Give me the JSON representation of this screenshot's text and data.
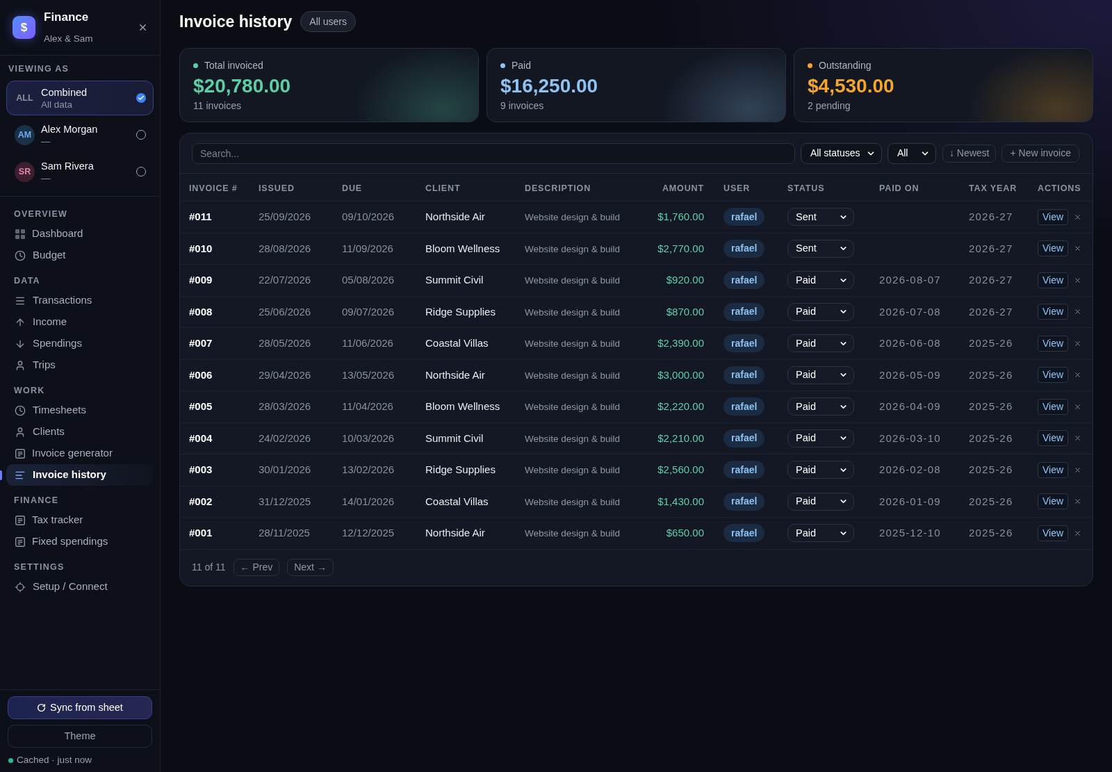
{
  "sidebar": {
    "app": {
      "logo": "$",
      "title": "Finance",
      "subtitle": "Alex & Sam"
    },
    "viewing_as": {
      "heading": "VIEWING AS",
      "options": [
        {
          "kind": "all",
          "badge": "ALL",
          "name": "Combined",
          "detail": "All data",
          "selected": true
        },
        {
          "kind": "person",
          "badge": "AM",
          "name": "Alex Morgan",
          "detail": "—",
          "selected": false,
          "color": "#1b3148"
        },
        {
          "kind": "person",
          "badge": "SR",
          "name": "Sam Rivera",
          "detail": "—",
          "selected": false,
          "color": "#3d1f2e"
        }
      ]
    },
    "nav": [
      {
        "heading": "OVERVIEW",
        "items": [
          {
            "label": "Dashboard",
            "selected": false
          },
          {
            "label": "Budget",
            "selected": false
          }
        ]
      },
      {
        "heading": "DATA",
        "items": [
          {
            "label": "Transactions",
            "selected": false
          },
          {
            "label": "Income",
            "selected": false
          },
          {
            "label": "Spendings",
            "selected": false
          },
          {
            "label": "Trips",
            "selected": false
          }
        ]
      },
      {
        "heading": "WORK",
        "items": [
          {
            "label": "Timesheets",
            "selected": false
          },
          {
            "label": "Clients",
            "selected": false
          },
          {
            "label": "Invoice generator",
            "selected": false
          },
          {
            "label": "Invoice history",
            "selected": true
          }
        ]
      },
      {
        "heading": "FINANCE",
        "items": [
          {
            "label": "Tax tracker",
            "selected": false
          },
          {
            "label": "Fixed spendings",
            "selected": false
          }
        ]
      },
      {
        "heading": "SETTINGS",
        "items": [
          {
            "label": "Setup / Connect",
            "selected": false
          }
        ]
      }
    ],
    "sync_button": "Sync from sheet",
    "theme_button": "Theme",
    "status": "Cached · just now"
  },
  "header": {
    "title": "Invoice history",
    "scope": "All users"
  },
  "summary_cards": [
    {
      "label": "Total invoiced",
      "value": "$20,780.00",
      "note": "11 invoices",
      "color": "#5ccfa5"
    },
    {
      "label": "Paid",
      "value": "$16,250.00",
      "note": "9 invoices",
      "color": "#8ec3f2"
    },
    {
      "label": "Outstanding",
      "value": "$4,530.00",
      "note": "2 pending",
      "color": "#f4a52a"
    }
  ],
  "invoices": {
    "search": {
      "placeholder": "Search..."
    },
    "status_filter": "All statuses",
    "period_filter": "All",
    "sort_button": "↓ Newest",
    "new_button": "+ New invoice",
    "columns": [
      "INVOICE #",
      "ISSUED",
      "DUE",
      "CLIENT",
      "DESCRIPTION",
      "AMOUNT",
      "USER",
      "STATUS",
      "PAID ON",
      "TAX YEAR",
      "ACTIONS"
    ],
    "rows": [
      {
        "invoice": "#011",
        "issued": "25/09/2026",
        "due": "09/10/2026",
        "client": "Northside Air",
        "description": "Website design & build",
        "amount": "$1,760.00",
        "user": "rafael",
        "status": "Sent",
        "tax_year": "2026-27",
        "action": "View"
      },
      {
        "invoice": "#010",
        "issued": "28/08/2026",
        "due": "11/09/2026",
        "client": "Bloom Wellness",
        "description": "Website design & build",
        "amount": "$2,770.00",
        "user": "rafael",
        "status": "Sent",
        "tax_year": "2026-27",
        "action": "View"
      },
      {
        "invoice": "#009",
        "issued": "22/07/2026",
        "due": "05/08/2026",
        "client": "Summit Civil",
        "description": "Website design & build",
        "amount": "$920.00",
        "user": "rafael",
        "status": "Paid",
        "paid_on": "2026-08-07",
        "tax_year": "2026-27",
        "action": "View"
      },
      {
        "invoice": "#008",
        "issued": "25/06/2026",
        "due": "09/07/2026",
        "client": "Ridge Supplies",
        "description": "Website design & build",
        "amount": "$870.00",
        "user": "rafael",
        "status": "Paid",
        "paid_on": "2026-07-08",
        "tax_year": "2026-27",
        "action": "View"
      },
      {
        "invoice": "#007",
        "issued": "28/05/2026",
        "due": "11/06/2026",
        "client": "Coastal Villas",
        "description": "Website design & build",
        "amount": "$2,390.00",
        "user": "rafael",
        "status": "Paid",
        "paid_on": "2026-06-08",
        "tax_year": "2025-26",
        "action": "View"
      },
      {
        "invoice": "#006",
        "issued": "29/04/2026",
        "due": "13/05/2026",
        "client": "Northside Air",
        "description": "Website design & build",
        "amount": "$3,000.00",
        "user": "rafael",
        "status": "Paid",
        "paid_on": "2026-05-09",
        "tax_year": "2025-26",
        "action": "View"
      },
      {
        "invoice": "#005",
        "issued": "28/03/2026",
        "due": "11/04/2026",
        "client": "Bloom Wellness",
        "description": "Website design & build",
        "amount": "$2,220.00",
        "user": "rafael",
        "status": "Paid",
        "paid_on": "2026-04-09",
        "tax_year": "2025-26",
        "action": "View"
      },
      {
        "invoice": "#004",
        "issued": "24/02/2026",
        "due": "10/03/2026",
        "client": "Summit Civil",
        "description": "Website design & build",
        "amount": "$2,210.00",
        "user": "rafael",
        "status": "Paid",
        "paid_on": "2026-03-10",
        "tax_year": "2025-26",
        "action": "View"
      },
      {
        "invoice": "#003",
        "issued": "30/01/2026",
        "due": "13/02/2026",
        "client": "Ridge Supplies",
        "description": "Website design & build",
        "amount": "$2,560.00",
        "user": "rafael",
        "status": "Paid",
        "paid_on": "2026-02-08",
        "tax_year": "2025-26",
        "action": "View"
      },
      {
        "invoice": "#002",
        "issued": "31/12/2025",
        "due": "14/01/2026",
        "client": "Coastal Villas",
        "description": "Website design & build",
        "amount": "$1,430.00",
        "user": "rafael",
        "status": "Paid",
        "paid_on": "2026-01-09",
        "tax_year": "2025-26",
        "action": "View"
      },
      {
        "invoice": "#001",
        "issued": "28/11/2025",
        "due": "12/12/2025",
        "client": "Northside Air",
        "description": "Website design & build",
        "amount": "$650.00",
        "user": "rafael",
        "status": "Paid",
        "paid_on": "2025-12-10",
        "tax_year": "2025-26",
        "action": "View"
      }
    ],
    "pagination": {
      "count": "11 of 11",
      "prev": "← Prev",
      "next": "Next →"
    }
  }
}
